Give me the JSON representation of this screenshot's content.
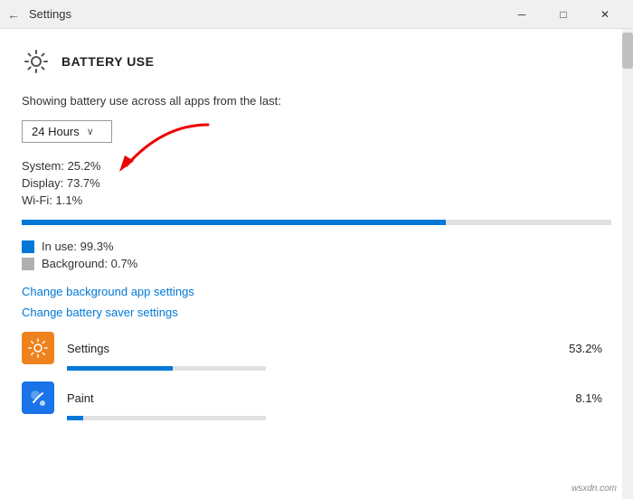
{
  "titlebar": {
    "back_icon": "←",
    "title": "Settings",
    "controls": {
      "minimize": "─",
      "maximize": "□",
      "close": "✕"
    }
  },
  "page": {
    "icon": "⚙",
    "title": "BATTERY USE",
    "description": "Showing battery use across all apps from the last:",
    "dropdown": {
      "label": "24 Hours",
      "chevron": "∨"
    },
    "stats": [
      {
        "label": "System: 25.2%"
      },
      {
        "label": "Display: 73.7%"
      },
      {
        "label": "Wi-Fi: 1.1%"
      }
    ],
    "progress_bar": {
      "fill_percent": 72
    },
    "legend": [
      {
        "type": "blue",
        "label": "In use: 99.3%"
      },
      {
        "type": "gray",
        "label": "Background: 0.7%"
      }
    ],
    "links": [
      {
        "label": "Change background app settings"
      },
      {
        "label": "Change battery saver settings"
      }
    ],
    "apps": [
      {
        "name": "Settings",
        "percent": "53.2%",
        "icon_type": "settings-orange",
        "icon_char": "⚙",
        "bar_fill": 53
      },
      {
        "name": "Paint",
        "percent": "8.1%",
        "icon_type": "paint-blue",
        "icon_char": "🎨",
        "bar_fill": 8
      }
    ]
  },
  "watermark": {
    "text": "wsxdn.com"
  }
}
